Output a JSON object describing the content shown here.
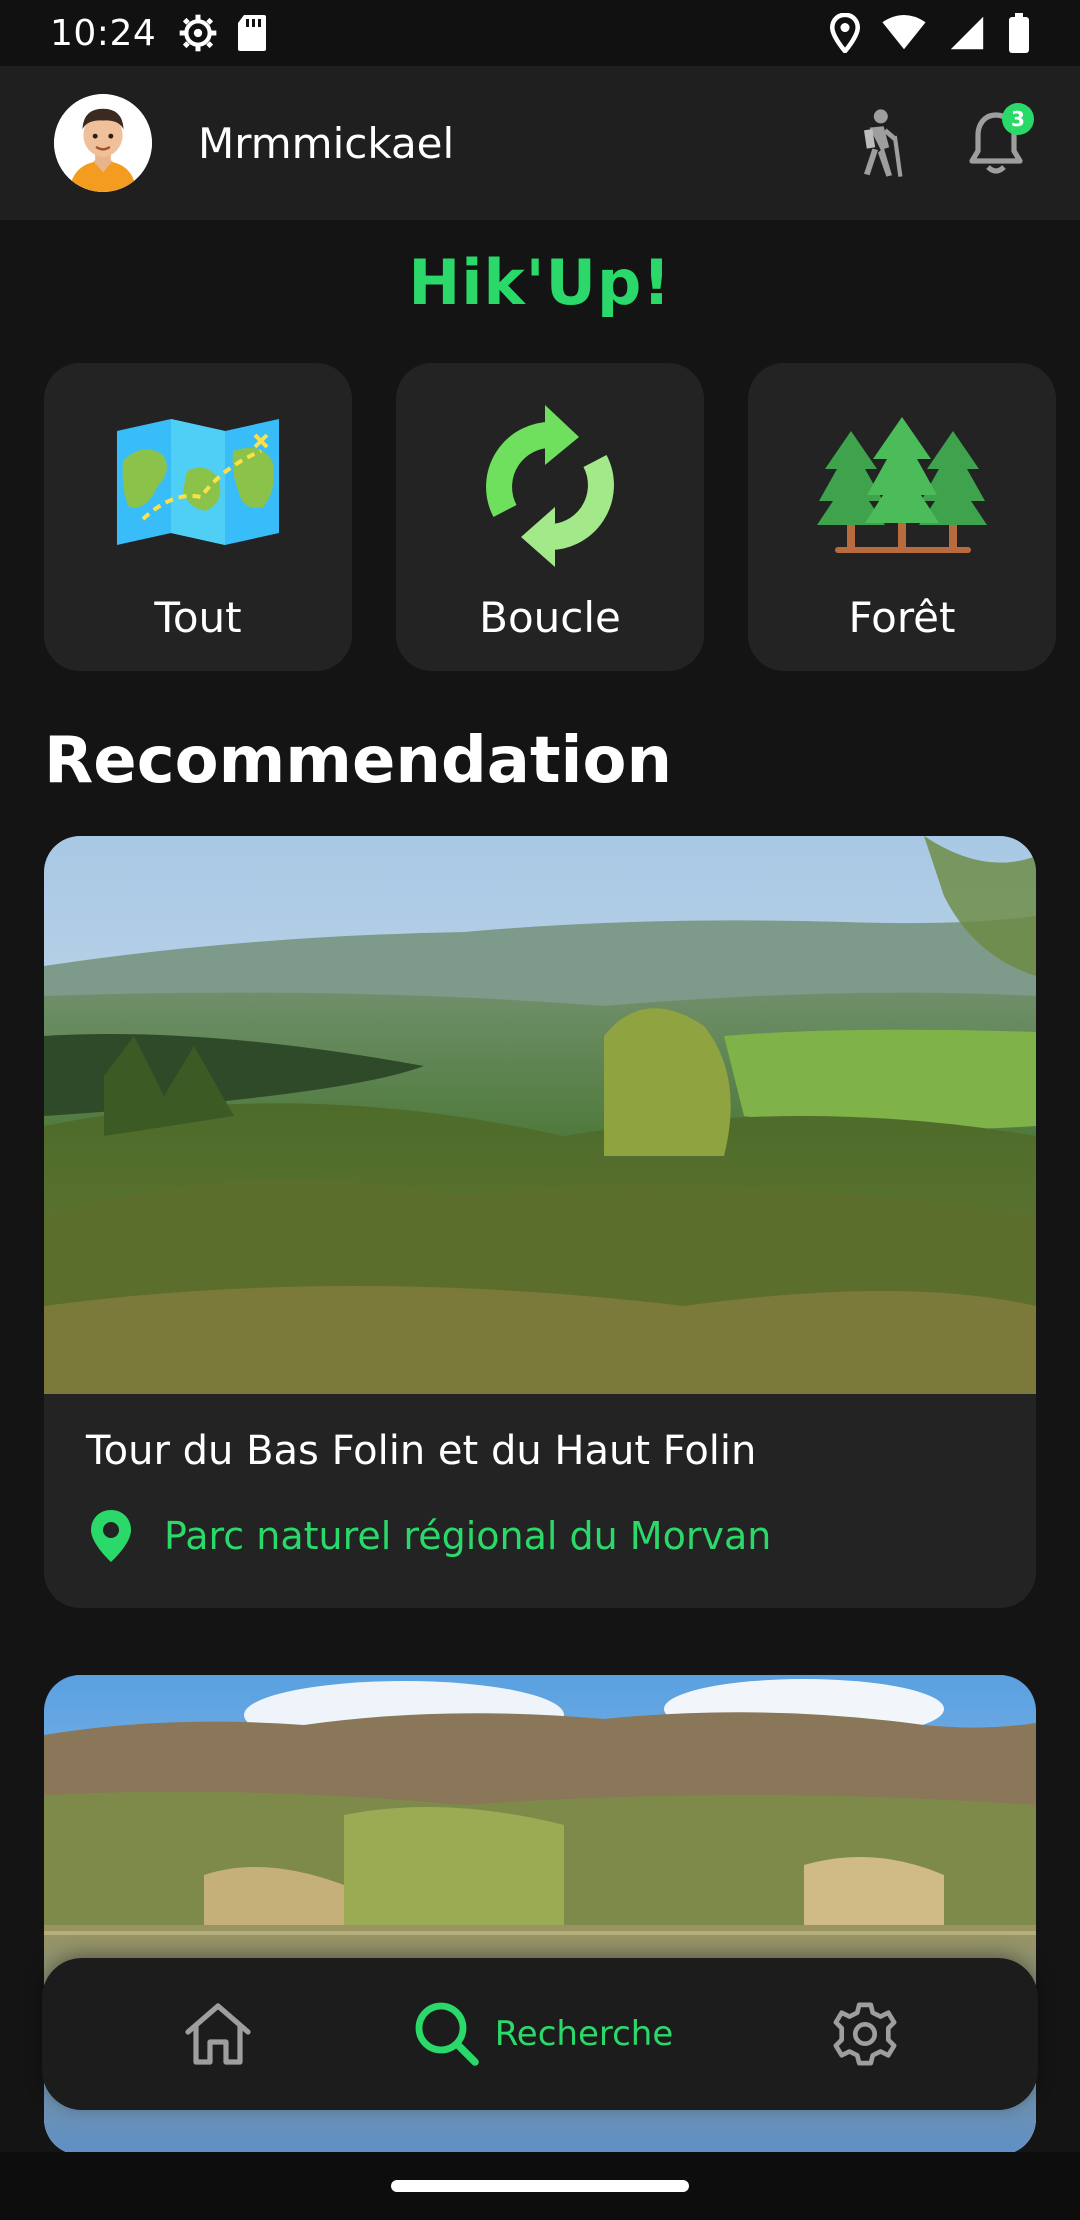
{
  "status_bar": {
    "time": "10:24",
    "left_icons": [
      "settings-gear-icon",
      "sd-card-icon"
    ],
    "right_icons": [
      "location-icon",
      "wifi-icon",
      "signal-icon",
      "battery-icon"
    ]
  },
  "header": {
    "username": "Mrmmickael",
    "avatar_icon": "avatar",
    "actions": [
      "hiker-icon",
      "bell-icon"
    ],
    "notification_count": "3"
  },
  "brand": {
    "title": "Hik'Up!"
  },
  "categories": [
    {
      "label": "Tout",
      "icon": "treasure-map-icon"
    },
    {
      "label": "Boucle",
      "icon": "loop-arrows-icon"
    },
    {
      "label": "Forêt",
      "icon": "forest-trees-icon"
    }
  ],
  "recommendation": {
    "section_title": "Recommendation",
    "items": [
      {
        "title": "Tour du Bas Folin et du Haut Folin",
        "location": "Parc naturel régional du Morvan",
        "location_icon": "map-pin-icon"
      },
      {
        "title": "",
        "location": ""
      }
    ]
  },
  "bottom_nav": {
    "items": [
      {
        "icon": "home-icon",
        "label": ""
      },
      {
        "icon": "search-icon",
        "label": "Recherche",
        "active": true
      },
      {
        "icon": "settings-icon",
        "label": ""
      }
    ]
  },
  "colors": {
    "accent": "#2bd96a",
    "background": "#141414",
    "card": "#232323",
    "header": "#1f1f1f"
  }
}
